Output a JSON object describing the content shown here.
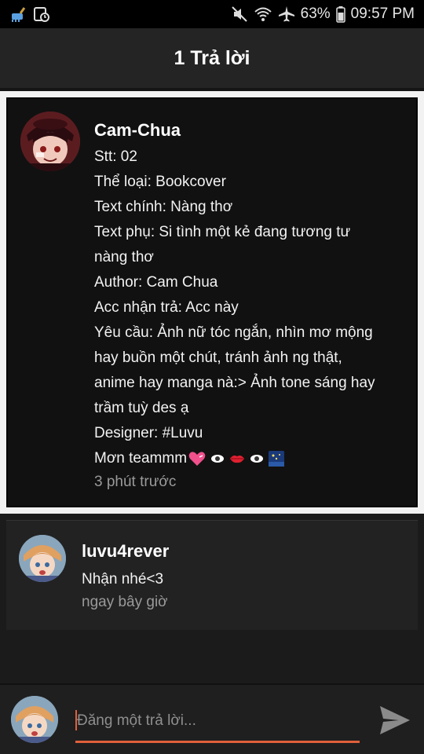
{
  "status_bar": {
    "battery": "63%",
    "time": "09:57 PM"
  },
  "header": {
    "title": "1 Trả lời"
  },
  "post": {
    "author": "Cam-Chua",
    "lines": [
      "Stt: 02",
      "Thể loại: Bookcover",
      "Text chính: Nàng thơ",
      "Text phụ: Si tình một kẻ đang tương tư",
      "nàng thơ",
      "Author: Cam Chua",
      "Acc nhận trả: Acc này",
      "Yêu cầu: Ảnh nữ tóc ngắn, nhìn mơ mộng",
      "hay buồn một chút, tránh ảnh ng thật,",
      "anime hay manga nà:> Ảnh tone sáng hay",
      "trầm tuỳ des ạ",
      "Designer: #Luvu"
    ],
    "last_line": "Mơn teammm",
    "timestamp": "3 phút trước"
  },
  "reply": {
    "author": "luvu4rever",
    "text": "Nhận nhé<3",
    "timestamp": "ngay bây giờ"
  },
  "composer": {
    "placeholder": "Đăng một trả lời..."
  },
  "colors": {
    "accent": "#e0603a",
    "background": "#1b1b1b",
    "card": "#111111"
  }
}
